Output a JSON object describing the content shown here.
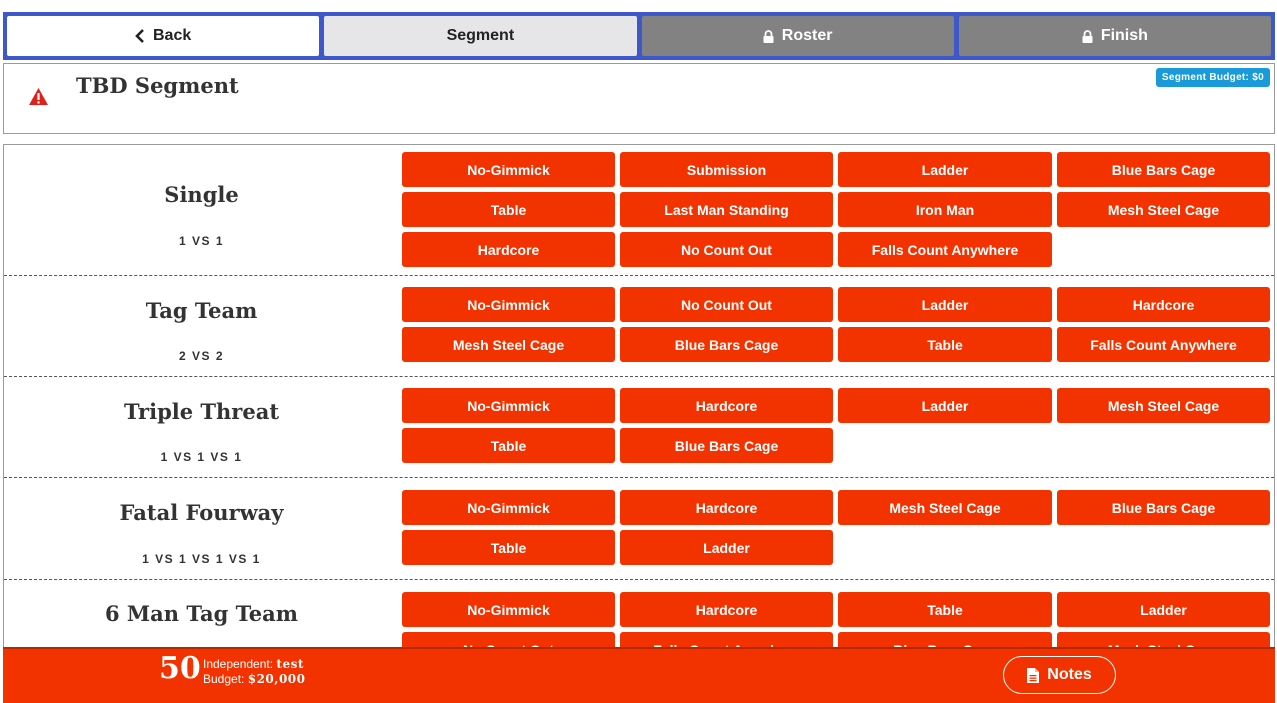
{
  "nav": {
    "back": "Back",
    "segment": "Segment",
    "roster": "Roster",
    "finish": "Finish"
  },
  "segment": {
    "title": "TBD Segment",
    "budget": "Segment Budget: $0"
  },
  "matches": [
    {
      "name": "Single",
      "vs": "1 VS 1",
      "stipulations": [
        "No-Gimmick",
        "Submission",
        "Ladder",
        "Blue Bars Cage",
        "Table",
        "Last Man Standing",
        "Iron Man",
        "Mesh Steel Cage",
        "Hardcore",
        "No Count Out",
        "Falls Count Anywhere"
      ]
    },
    {
      "name": "Tag Team",
      "vs": "2 VS 2",
      "stipulations": [
        "No-Gimmick",
        "No Count Out",
        "Ladder",
        "Hardcore",
        "Mesh Steel Cage",
        "Blue Bars Cage",
        "Table",
        "Falls Count Anywhere"
      ]
    },
    {
      "name": "Triple Threat",
      "vs": "1 VS 1 VS 1",
      "stipulations": [
        "No-Gimmick",
        "Hardcore",
        "Ladder",
        "Mesh Steel Cage",
        "Table",
        "Blue Bars Cage"
      ]
    },
    {
      "name": "Fatal Fourway",
      "vs": "1 VS 1 VS 1 VS 1",
      "stipulations": [
        "No-Gimmick",
        "Hardcore",
        "Mesh Steel Cage",
        "Blue Bars Cage",
        "Table",
        "Ladder"
      ]
    },
    {
      "name": "6 Man Tag Team",
      "vs": "",
      "stipulations": [
        "No-Gimmick",
        "Hardcore",
        "Table",
        "Ladder",
        "No Count Out",
        "Falls Count Anywhere",
        "Blue Bars Cage",
        "Mesh Steel Cage"
      ]
    }
  ],
  "footer": {
    "score": "50",
    "promotion_label": "Independent:",
    "promotion_value": "test",
    "budget_label": "Budget:",
    "budget_value": "$20,000",
    "notes": "Notes"
  },
  "colors": {
    "accent": "#f23300",
    "nav_border": "#3e57c9",
    "locked": "#828282",
    "badge": "#1a9ad8"
  }
}
